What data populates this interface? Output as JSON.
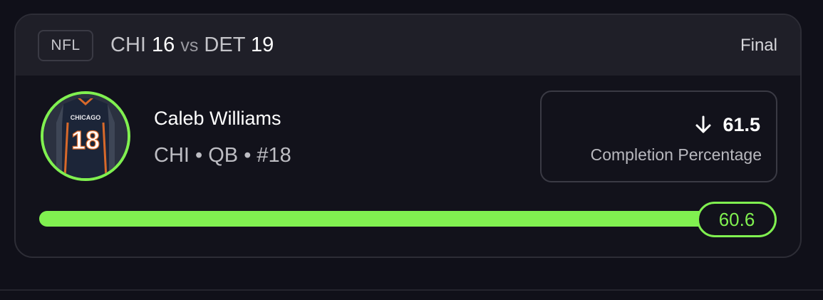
{
  "header": {
    "league": "NFL",
    "home_team": "CHI",
    "home_score": "16",
    "separator": "vs",
    "away_team": "DET",
    "away_score": "19",
    "status": "Final"
  },
  "player": {
    "name": "Caleb Williams",
    "team": "CHI",
    "position": "QB",
    "number": "#18",
    "jersey_text": "CHICAGO",
    "jersey_number": "18",
    "meta_separator": "•"
  },
  "projection": {
    "direction_icon": "arrow-down-icon",
    "line_value": "61.5",
    "stat_label": "Completion Percentage"
  },
  "result": {
    "actual_value": "60.6",
    "progress_fraction": 0.988
  },
  "colors": {
    "accent": "#80f050",
    "background": "#101019",
    "card": "#12121b",
    "header": "#1f1f28"
  }
}
